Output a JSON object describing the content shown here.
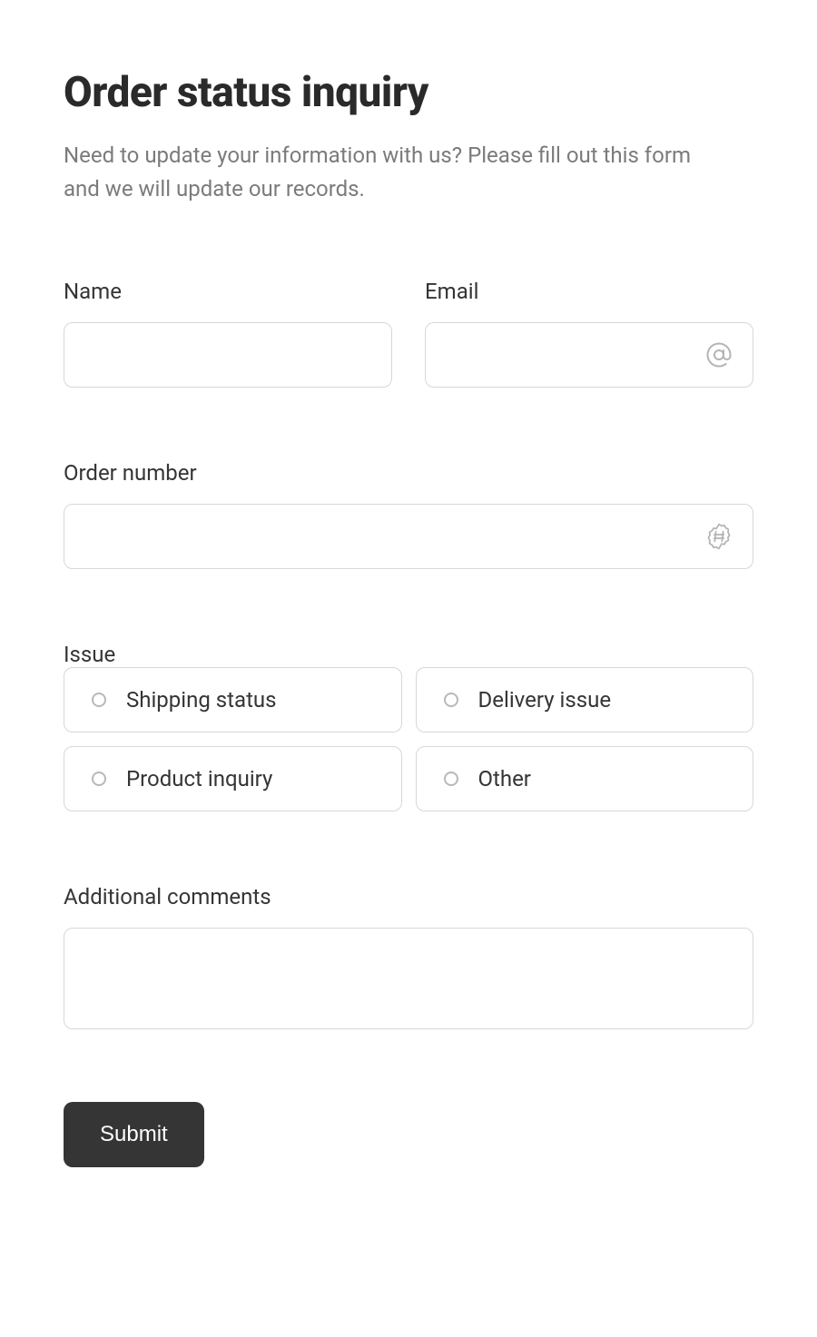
{
  "header": {
    "title": "Order status inquiry",
    "subtitle": "Need to update your information with us? Please fill out this form and we will update our records."
  },
  "fields": {
    "name": {
      "label": "Name",
      "value": ""
    },
    "email": {
      "label": "Email",
      "value": ""
    },
    "order_number": {
      "label": "Order number",
      "value": ""
    },
    "issue": {
      "label": "Issue",
      "options": [
        "Shipping status",
        "Delivery issue",
        "Product inquiry",
        "Other"
      ]
    },
    "comments": {
      "label": "Additional comments",
      "value": ""
    }
  },
  "actions": {
    "submit": "Submit"
  }
}
